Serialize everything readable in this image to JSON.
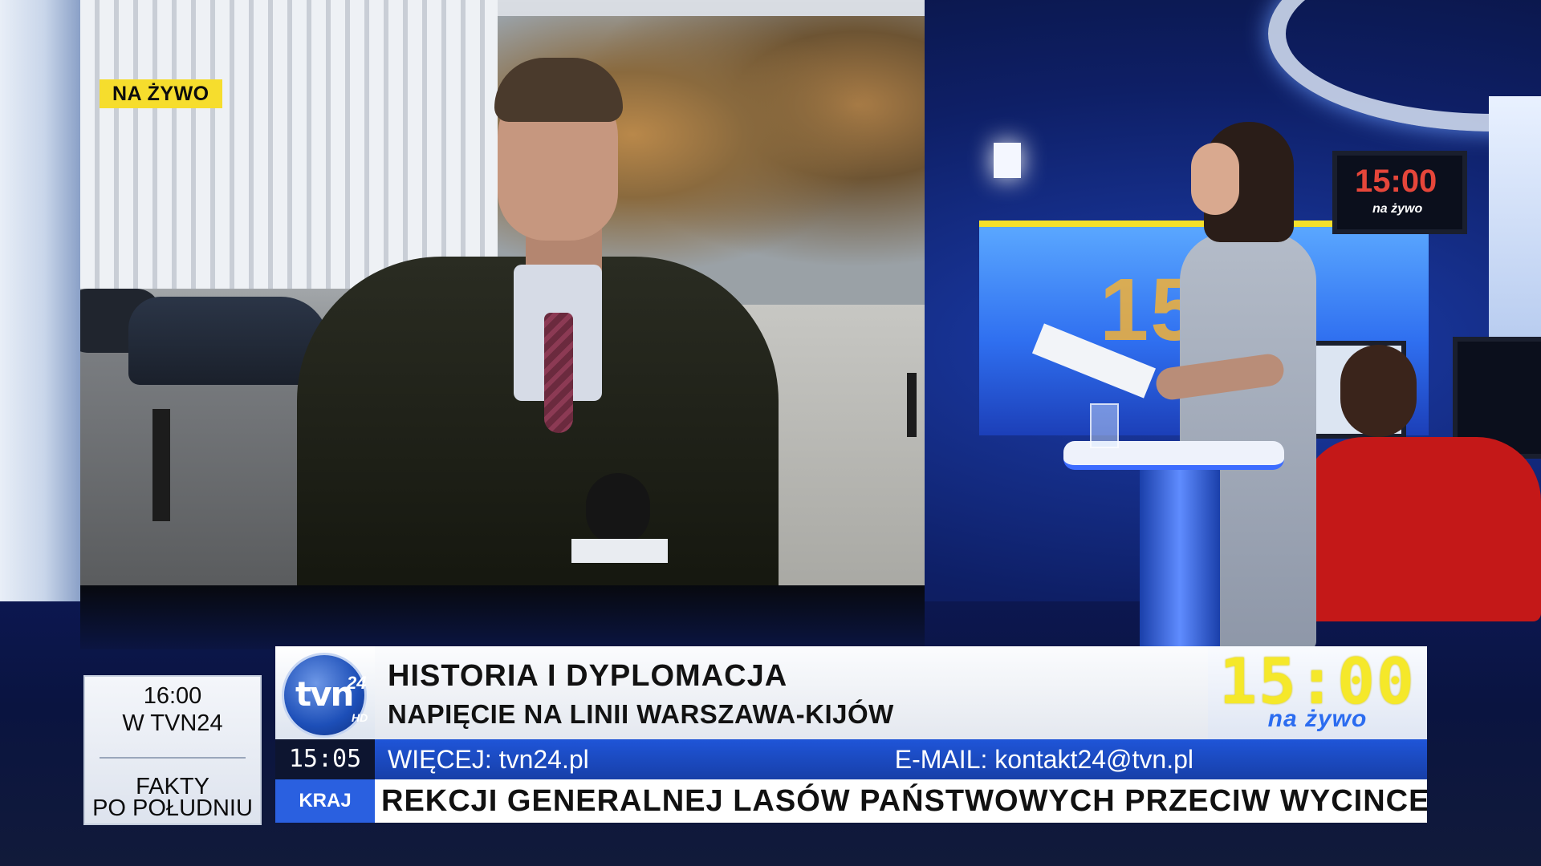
{
  "live_badge": "NA ŻYWO",
  "promo": {
    "time": "16:00",
    "channel": "W TVN24",
    "show_line1": "FAKTY",
    "show_line2": "PO POŁUDNIU"
  },
  "logo": {
    "name": "tvn",
    "superscript": "24",
    "hd": "HD"
  },
  "headline": {
    "title": "HISTORIA I DYPLOMACJA",
    "subtitle": "NAPIĘCIE NA LINII WARSZAWA-KIJÓW"
  },
  "live_box": {
    "time": "15:00",
    "label": "na żywo"
  },
  "info_bar": {
    "clock": "15:05",
    "more": "WIĘCEJ: tvn24.pl",
    "email": "E-MAIL: kontakt24@tvn.pl"
  },
  "ticker": {
    "category": "KRAJ",
    "text": "REKCJI GENERALNEJ LASÓW PAŃSTWOWYCH PRZECIW WYCINCE W"
  },
  "studio_monitor": {
    "time": "15:00",
    "label": "na żywo"
  },
  "colors": {
    "live_yellow": "#f6dd2d",
    "brand_blue": "#1f55d8",
    "clock_bg": "#0d1530"
  }
}
